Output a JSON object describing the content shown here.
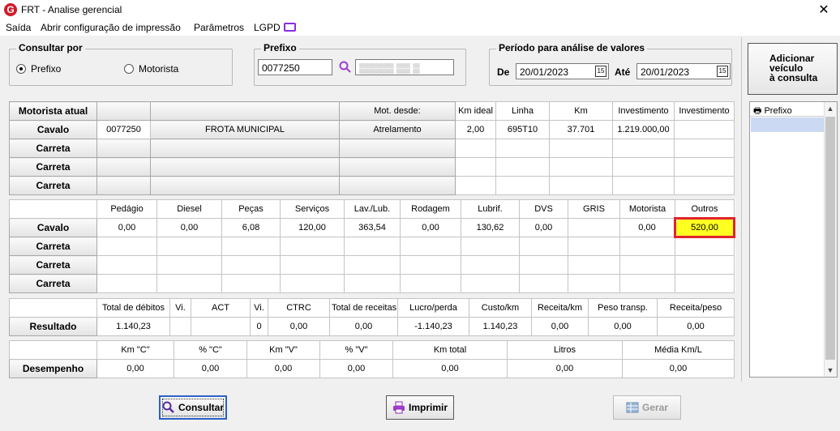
{
  "window": {
    "title": "FRT - Analise gerencial",
    "app_icon": "G"
  },
  "menu": [
    "Saída",
    "Abrir configuração de impressão",
    "Parâmetros",
    "LGPD"
  ],
  "consultar_por": {
    "title": "Consultar por",
    "options": [
      "Prefixo",
      "Motorista"
    ],
    "selected": "Prefixo"
  },
  "prefixo": {
    "title": "Prefixo",
    "value": "0077250",
    "masked_value": "▒▒▒▒▒ ▒▒ ▒"
  },
  "periodo": {
    "title": "Período para análise de valores",
    "de_label": "De",
    "de_value": "20/01/2023",
    "ate_label": "Até",
    "ate_value": "20/01/2023",
    "calendar_glyph": "15"
  },
  "add_button": {
    "line1": "Adicionar",
    "line2": "veículo",
    "line3": "à consulta"
  },
  "prefix_list": {
    "header": "Prefixo"
  },
  "table1": {
    "headers": [
      "Motorista atual",
      "",
      "",
      "Mot. desde:",
      "Km ideal",
      "Linha",
      "Km",
      "Investimento",
      "Investimento"
    ],
    "rows": [
      [
        "Cavalo",
        "0077250",
        "FROTA MUNICIPAL",
        "Atrelamento",
        "2,00",
        "695T10",
        "37.701",
        "1.219.000,00",
        ""
      ],
      [
        "Carreta",
        "",
        "",
        "",
        "",
        "",
        "",
        "",
        ""
      ],
      [
        "Carreta",
        "",
        "",
        "",
        "",
        "",
        "",
        "",
        ""
      ],
      [
        "Carreta",
        "",
        "",
        "",
        "",
        "",
        "",
        "",
        ""
      ]
    ]
  },
  "table2": {
    "headers": [
      "",
      "Pedágio",
      "Diesel",
      "Peças",
      "Serviços",
      "Lav./Lub.",
      "Rodagem",
      "Lubrif.",
      "DVS",
      "GRIS",
      "Motorista",
      "Outros"
    ],
    "rows": [
      [
        "Cavalo",
        "0,00",
        "0,00",
        "6,08",
        "120,00",
        "363,54",
        "0,00",
        "130,62",
        "0,00",
        "",
        "0,00",
        "520,00"
      ],
      [
        "Carreta",
        "",
        "",
        "",
        "",
        "",
        "",
        "",
        "",
        "",
        "",
        ""
      ],
      [
        "Carreta",
        "",
        "",
        "",
        "",
        "",
        "",
        "",
        "",
        "",
        "",
        ""
      ],
      [
        "Carreta",
        "",
        "",
        "",
        "",
        "",
        "",
        "",
        "",
        "",
        "",
        ""
      ]
    ]
  },
  "table3": {
    "headers": [
      "",
      "Total de débitos",
      "Vi.",
      "ACT",
      "Vi.",
      "CTRC",
      "Total de receitas",
      "Lucro/perda",
      "Custo/km",
      "Receita/km",
      "Peso transp.",
      "Receita/peso"
    ],
    "row": [
      "Resultado",
      "1.140,23",
      "",
      "",
      "0",
      "0,00",
      "0,00",
      "-1.140,23",
      "1.140,23",
      "0,00",
      "0,00",
      "0,00"
    ]
  },
  "table4": {
    "headers": [
      "",
      "Km \"C\"",
      "% \"C\"",
      "Km \"V\"",
      "% \"V\"",
      "Km total",
      "Litros",
      "Média Km/L"
    ],
    "row": [
      "Desempenho",
      "0,00",
      "0,00",
      "0,00",
      "0,00",
      "0,00",
      "0,00",
      "0,00"
    ]
  },
  "buttons": {
    "consultar": "Consultar",
    "imprimir": "Imprimir",
    "gerar": "Gerar"
  },
  "colors": {
    "highlight": "#ffff22",
    "highlight_border": "#e0242c",
    "accent": "#2a62c9"
  }
}
